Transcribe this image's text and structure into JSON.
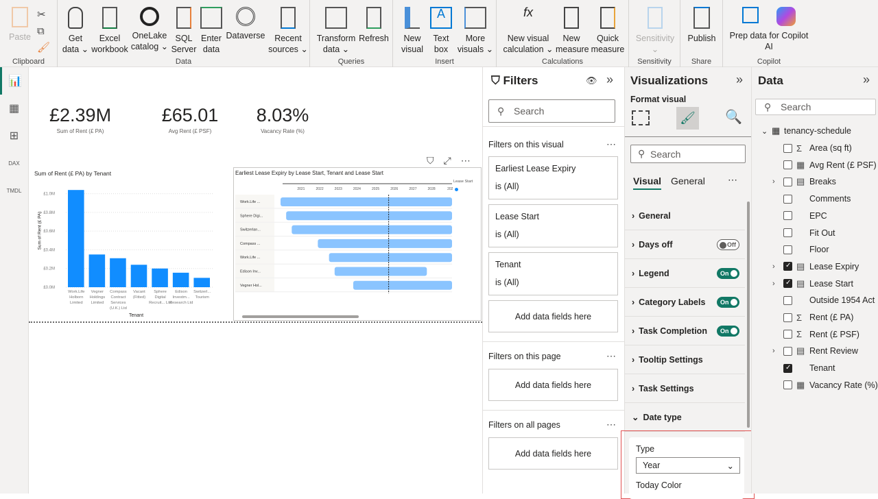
{
  "ribbon": {
    "groups": [
      {
        "label": "Clipboard"
      },
      {
        "label": "Data"
      },
      {
        "label": "Queries"
      },
      {
        "label": "Insert"
      },
      {
        "label": "Calculations"
      },
      {
        "label": "Sensitivity"
      },
      {
        "label": "Share"
      },
      {
        "label": "Copilot"
      }
    ],
    "buttons": {
      "paste": "Paste",
      "get_data": "Get data",
      "excel": "Excel workbook",
      "onelake": "OneLake catalog",
      "sql": "SQL Server",
      "enter": "Enter data",
      "dataverse": "Dataverse",
      "recent": "Recent sources",
      "transform": "Transform data",
      "refresh": "Refresh",
      "new_visual": "New visual",
      "text_box": "Text box",
      "more_visuals": "More visuals",
      "new_visual_calc": "New visual calculation",
      "new_measure": "New measure",
      "quick_measure": "Quick measure",
      "sensitivity": "Sensitivity",
      "publish": "Publish",
      "prep": "Prep data for Copilot",
      "ai": "AI"
    }
  },
  "rail": {
    "dax": "DAX",
    "tmdl": "TMDL"
  },
  "kpis": [
    {
      "value": "£2.39M",
      "label": "Sum of Rent (£ PA)"
    },
    {
      "value": "£65.01",
      "label": "Avg Rent (£ PSF)"
    },
    {
      "value": "8.03%",
      "label": "Vacancy Rate (%)"
    }
  ],
  "chart_data": [
    {
      "type": "bar",
      "title": "Sum of Rent (£ PA) by Tenant",
      "xlabel": "Tenant",
      "ylabel": "Sum of Rent (£ PA)",
      "ylim": [
        0,
        1.1
      ],
      "yticks": [
        "£0.0M",
        "£0.2M",
        "£0.4M",
        "£0.6M",
        "£0.8M",
        "£1.0M"
      ],
      "categories": [
        "Work.Life Holborn Limited",
        "Vegner Holdings Limited",
        "Compass Contract Services (U.K.) Ltd",
        "Vacant (Fitted)",
        "Sphere Digital Recruit... Ltd",
        "Edison Investm... Research Ltd",
        "Switzerl... Tourism"
      ],
      "values": [
        1.04,
        0.35,
        0.31,
        0.24,
        0.2,
        0.155,
        0.1
      ],
      "color": "#118dff"
    },
    {
      "type": "gantt",
      "title": "Earliest Lease Expiry by Lease Start, Tenant and Lease Start",
      "legend": "Lease Start",
      "legend_color": "#118dff",
      "xticks": [
        "2021",
        "2022",
        "2023",
        "2024",
        "2025",
        "2026",
        "2027",
        "2028",
        "202"
      ],
      "xlim": [
        2019.9,
        2029.1
      ],
      "today": 2025.7,
      "bar_color": "#8ac4ff",
      "rows": [
        {
          "label": "Work.Life ...",
          "start": 2019.9,
          "end": 2029.1
        },
        {
          "label": "Sphere Digi...",
          "start": 2020.2,
          "end": 2029.1
        },
        {
          "label": "Switzerlan...",
          "start": 2020.5,
          "end": 2029.1
        },
        {
          "label": "Compass ...",
          "start": 2021.9,
          "end": 2029.1
        },
        {
          "label": "Work.Life ...",
          "start": 2022.5,
          "end": 2029.1
        },
        {
          "label": "Edison Inv...",
          "start": 2022.8,
          "end": 2027.75
        },
        {
          "label": "Vegner Hol...",
          "start": 2023.8,
          "end": 2029.1
        }
      ]
    }
  ],
  "filters": {
    "title": "Filters",
    "search": "Search",
    "on_visual": "Filters on this visual",
    "cards": [
      {
        "name": "Earliest Lease Expiry",
        "state": "is (All)"
      },
      {
        "name": "Lease Start",
        "state": "is (All)"
      },
      {
        "name": "Tenant",
        "state": "is (All)"
      }
    ],
    "add": "Add data fields here",
    "on_page": "Filters on this page",
    "on_all": "Filters on all pages"
  },
  "viz": {
    "title": "Visualizations",
    "format": "Format visual",
    "search": "Search",
    "tabs": [
      "Visual",
      "General"
    ],
    "sections": [
      {
        "label": "General"
      },
      {
        "label": "Days off",
        "toggle": "Off"
      },
      {
        "label": "Legend",
        "toggle": "On"
      },
      {
        "label": "Category Labels",
        "toggle": "On"
      },
      {
        "label": "Task Completion",
        "toggle": "On"
      },
      {
        "label": "Tooltip Settings"
      },
      {
        "label": "Task Settings"
      },
      {
        "label": "Date type"
      }
    ],
    "type_label": "Type",
    "type_value": "Year",
    "today_color": "Today Color"
  },
  "data": {
    "title": "Data",
    "search": "Search",
    "table": "tenancy-schedule",
    "fields": [
      {
        "label": "Area (sq ft)",
        "icon": "Σ",
        "checked": false,
        "expand": false
      },
      {
        "label": "Avg Rent (£ PSF)",
        "icon": "▦",
        "checked": false,
        "expand": false
      },
      {
        "label": "Breaks",
        "icon": "▤",
        "checked": false,
        "expand": true
      },
      {
        "label": "Comments",
        "icon": "",
        "checked": false,
        "expand": false
      },
      {
        "label": "EPC",
        "icon": "",
        "checked": false,
        "expand": false
      },
      {
        "label": "Fit Out",
        "icon": "",
        "checked": false,
        "expand": false
      },
      {
        "label": "Floor",
        "icon": "",
        "checked": false,
        "expand": false
      },
      {
        "label": "Lease Expiry",
        "icon": "▤",
        "checked": true,
        "expand": true
      },
      {
        "label": "Lease Start",
        "icon": "▤",
        "checked": true,
        "expand": true
      },
      {
        "label": "Outside 1954 Act",
        "icon": "",
        "checked": false,
        "expand": false
      },
      {
        "label": "Rent (£ PA)",
        "icon": "Σ",
        "checked": false,
        "expand": false
      },
      {
        "label": "Rent (£ PSF)",
        "icon": "Σ",
        "checked": false,
        "expand": false
      },
      {
        "label": "Rent Review",
        "icon": "▤",
        "checked": false,
        "expand": true
      },
      {
        "label": "Tenant",
        "icon": "",
        "checked": true,
        "expand": false
      },
      {
        "label": "Vacancy Rate (%)",
        "icon": "▦",
        "checked": false,
        "expand": false
      }
    ]
  }
}
